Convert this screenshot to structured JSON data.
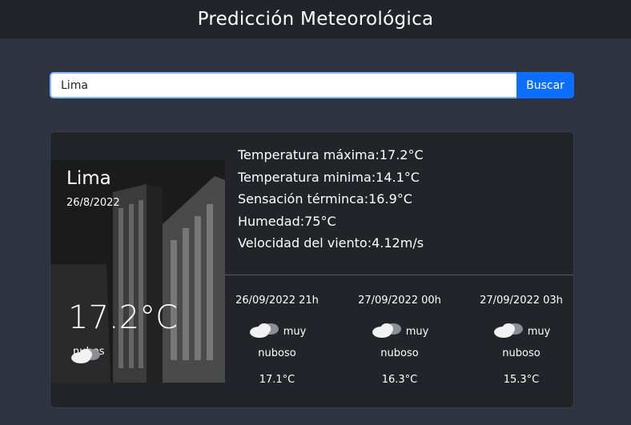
{
  "header": {
    "title": "Predicción Meteorológica"
  },
  "search": {
    "value": "Lima",
    "button_label": "Buscar"
  },
  "current": {
    "city": "Lima",
    "date": "26/8/2022",
    "temperature": "17.2°C",
    "condition": "nubes",
    "condition_icon": "cloud-icon"
  },
  "details": {
    "max_temp": "Temperatura máxima:17.2°C",
    "min_temp": "Temperatura minima:14.1°C",
    "feels_like": "Sensación términca:16.9°C",
    "humidity": "Humedad:75°C",
    "wind_speed": "Velocidad del viento:4.12m/s"
  },
  "forecast": [
    {
      "datetime": "26/09/2022 21h",
      "desc_line1": "muy",
      "desc_line2": "nuboso",
      "temp": "17.1°C",
      "icon": "cloud-icon"
    },
    {
      "datetime": "27/09/2022 00h",
      "desc_line1": "muy",
      "desc_line2": "nuboso",
      "temp": "16.3°C",
      "icon": "cloud-icon"
    },
    {
      "datetime": "27/09/2022 03h",
      "desc_line1": "muy",
      "desc_line2": "nuboso",
      "temp": "15.3°C",
      "icon": "cloud-icon"
    }
  ],
  "colors": {
    "background": "#2e3341",
    "header": "#212529",
    "card": "#212529",
    "button": "#0d6efd"
  }
}
